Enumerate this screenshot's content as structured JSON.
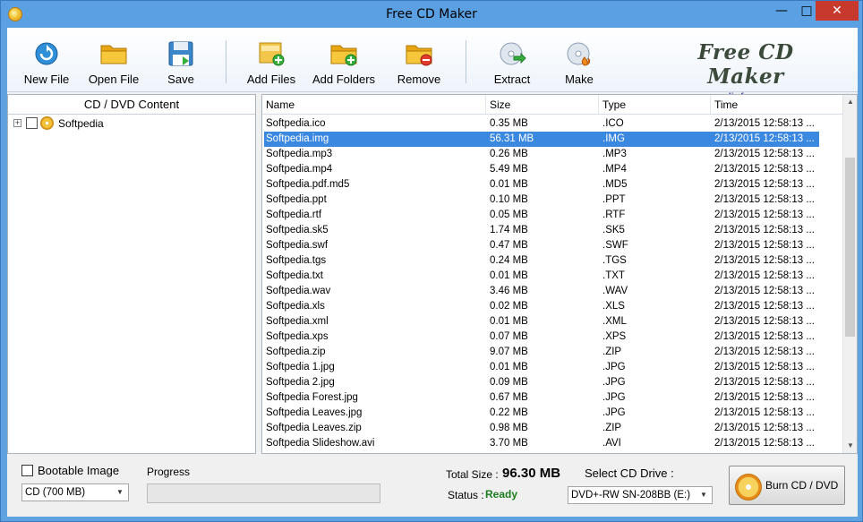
{
  "window": {
    "title": "Free CD Maker"
  },
  "toolbar": {
    "buttons": [
      {
        "label": "New File",
        "icon": "new-file-icon"
      },
      {
        "label": "Open File",
        "icon": "folder-open-icon"
      },
      {
        "label": "Save",
        "icon": "floppy-disk-icon"
      },
      {
        "label": "Add Files",
        "icon": "add-files-icon"
      },
      {
        "label": "Add Folders",
        "icon": "add-folder-icon"
      },
      {
        "label": "Remove",
        "icon": "remove-folder-icon"
      },
      {
        "label": "Extract",
        "icon": "disc-extract-icon"
      },
      {
        "label": "Make",
        "icon": "disc-make-icon"
      }
    ],
    "brand_name": "Free CD Maker",
    "brand_url": "www.mediafreeware.com"
  },
  "tree": {
    "header": "CD / DVD Content",
    "root": {
      "label": "Softpedia"
    }
  },
  "list": {
    "columns": [
      "Name",
      "Size",
      "Type",
      "Time"
    ],
    "rows": [
      {
        "name": "Softpedia.ico",
        "size": "0.35 MB",
        "type": ".ICO",
        "time": "2/13/2015 12:58:13 ..."
      },
      {
        "name": "Softpedia.img",
        "size": "56.31 MB",
        "type": ".IMG",
        "time": "2/13/2015 12:58:13 ..."
      },
      {
        "name": "Softpedia.mp3",
        "size": "0.26 MB",
        "type": ".MP3",
        "time": "2/13/2015 12:58:13 ..."
      },
      {
        "name": "Softpedia.mp4",
        "size": "5.49 MB",
        "type": ".MP4",
        "time": "2/13/2015 12:58:13 ..."
      },
      {
        "name": "Softpedia.pdf.md5",
        "size": "0.01 MB",
        "type": ".MD5",
        "time": "2/13/2015 12:58:13 ..."
      },
      {
        "name": "Softpedia.ppt",
        "size": "0.10 MB",
        "type": ".PPT",
        "time": "2/13/2015 12:58:13 ..."
      },
      {
        "name": "Softpedia.rtf",
        "size": "0.05 MB",
        "type": ".RTF",
        "time": "2/13/2015 12:58:13 ..."
      },
      {
        "name": "Softpedia.sk5",
        "size": "1.74 MB",
        "type": ".SK5",
        "time": "2/13/2015 12:58:13 ..."
      },
      {
        "name": "Softpedia.swf",
        "size": "0.47 MB",
        "type": ".SWF",
        "time": "2/13/2015 12:58:13 ..."
      },
      {
        "name": "Softpedia.tgs",
        "size": "0.24 MB",
        "type": ".TGS",
        "time": "2/13/2015 12:58:13 ..."
      },
      {
        "name": "Softpedia.txt",
        "size": "0.01 MB",
        "type": ".TXT",
        "time": "2/13/2015 12:58:13 ..."
      },
      {
        "name": "Softpedia.wav",
        "size": "3.46 MB",
        "type": ".WAV",
        "time": "2/13/2015 12:58:13 ..."
      },
      {
        "name": "Softpedia.xls",
        "size": "0.02 MB",
        "type": ".XLS",
        "time": "2/13/2015 12:58:13 ..."
      },
      {
        "name": "Softpedia.xml",
        "size": "0.01 MB",
        "type": ".XML",
        "time": "2/13/2015 12:58:13 ..."
      },
      {
        "name": "Softpedia.xps",
        "size": "0.07 MB",
        "type": ".XPS",
        "time": "2/13/2015 12:58:13 ..."
      },
      {
        "name": "Softpedia.zip",
        "size": "9.07 MB",
        "type": ".ZIP",
        "time": "2/13/2015 12:58:13 ..."
      },
      {
        "name": "Softpedia 1.jpg",
        "size": "0.01 MB",
        "type": ".JPG",
        "time": "2/13/2015 12:58:13 ..."
      },
      {
        "name": "Softpedia 2.jpg",
        "size": "0.09 MB",
        "type": ".JPG",
        "time": "2/13/2015 12:58:13 ..."
      },
      {
        "name": "Softpedia Forest.jpg",
        "size": "0.67 MB",
        "type": ".JPG",
        "time": "2/13/2015 12:58:13 ..."
      },
      {
        "name": "Softpedia Leaves.jpg",
        "size": "0.22 MB",
        "type": ".JPG",
        "time": "2/13/2015 12:58:13 ..."
      },
      {
        "name": "Softpedia Leaves.zip",
        "size": "0.98 MB",
        "type": ".ZIP",
        "time": "2/13/2015 12:58:13 ..."
      },
      {
        "name": "Softpedia Slideshow.avi",
        "size": "3.70 MB",
        "type": ".AVI",
        "time": "2/13/2015 12:58:13 ..."
      }
    ],
    "selected_index": 1
  },
  "bottom": {
    "bootable_label": "Bootable Image",
    "media_selected": "CD (700 MB)",
    "progress_label": "Progress",
    "progress_value": 0,
    "total_size_label": "Total Size :",
    "total_size_value": "96.30 MB",
    "status_label": "Status :",
    "status_value": "Ready",
    "drive_label": "Select CD Drive :",
    "drive_selected": "DVD+-RW SN-208BB (E:)",
    "burn_label": "Burn CD / DVD"
  },
  "colors": {
    "selection": "#3b88e0",
    "status_ready": "#1c7d1c",
    "title_bar": "#5aa0e2",
    "close_button": "#c7392c"
  }
}
